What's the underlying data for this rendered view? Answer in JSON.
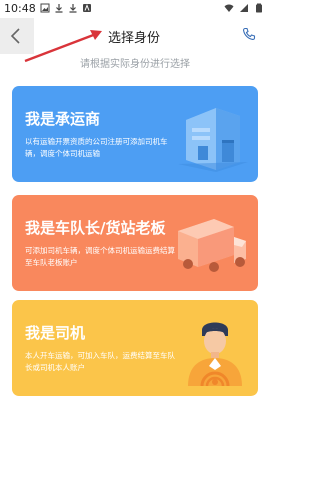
{
  "status_bar": {
    "time": "10:48"
  },
  "header": {
    "title": "选择身份",
    "subtitle": "请根据实际身份进行选择"
  },
  "cards": [
    {
      "title": "我是承运商",
      "desc": "以有运输开票资质的公司注册可添加司机车辆，调度个体司机运输",
      "color": "#4d9ef3"
    },
    {
      "title": "我是车队长/货站老板",
      "desc": "可添加司机车辆，调度个体司机运输运费结算至车队老板账户",
      "color": "#f9885d"
    },
    {
      "title": "我是司机",
      "desc": "本人开车运输，可加入车队，运费结算至车队长或司机本人账户",
      "color": "#fbc54a"
    }
  ],
  "icons": {
    "back": "chevron-left-icon",
    "phone": "phone-icon",
    "warehouse": "warehouse-icon",
    "truck": "truck-icon",
    "driver": "driver-icon"
  },
  "colors": {
    "annotation_arrow": "#d9343a"
  }
}
